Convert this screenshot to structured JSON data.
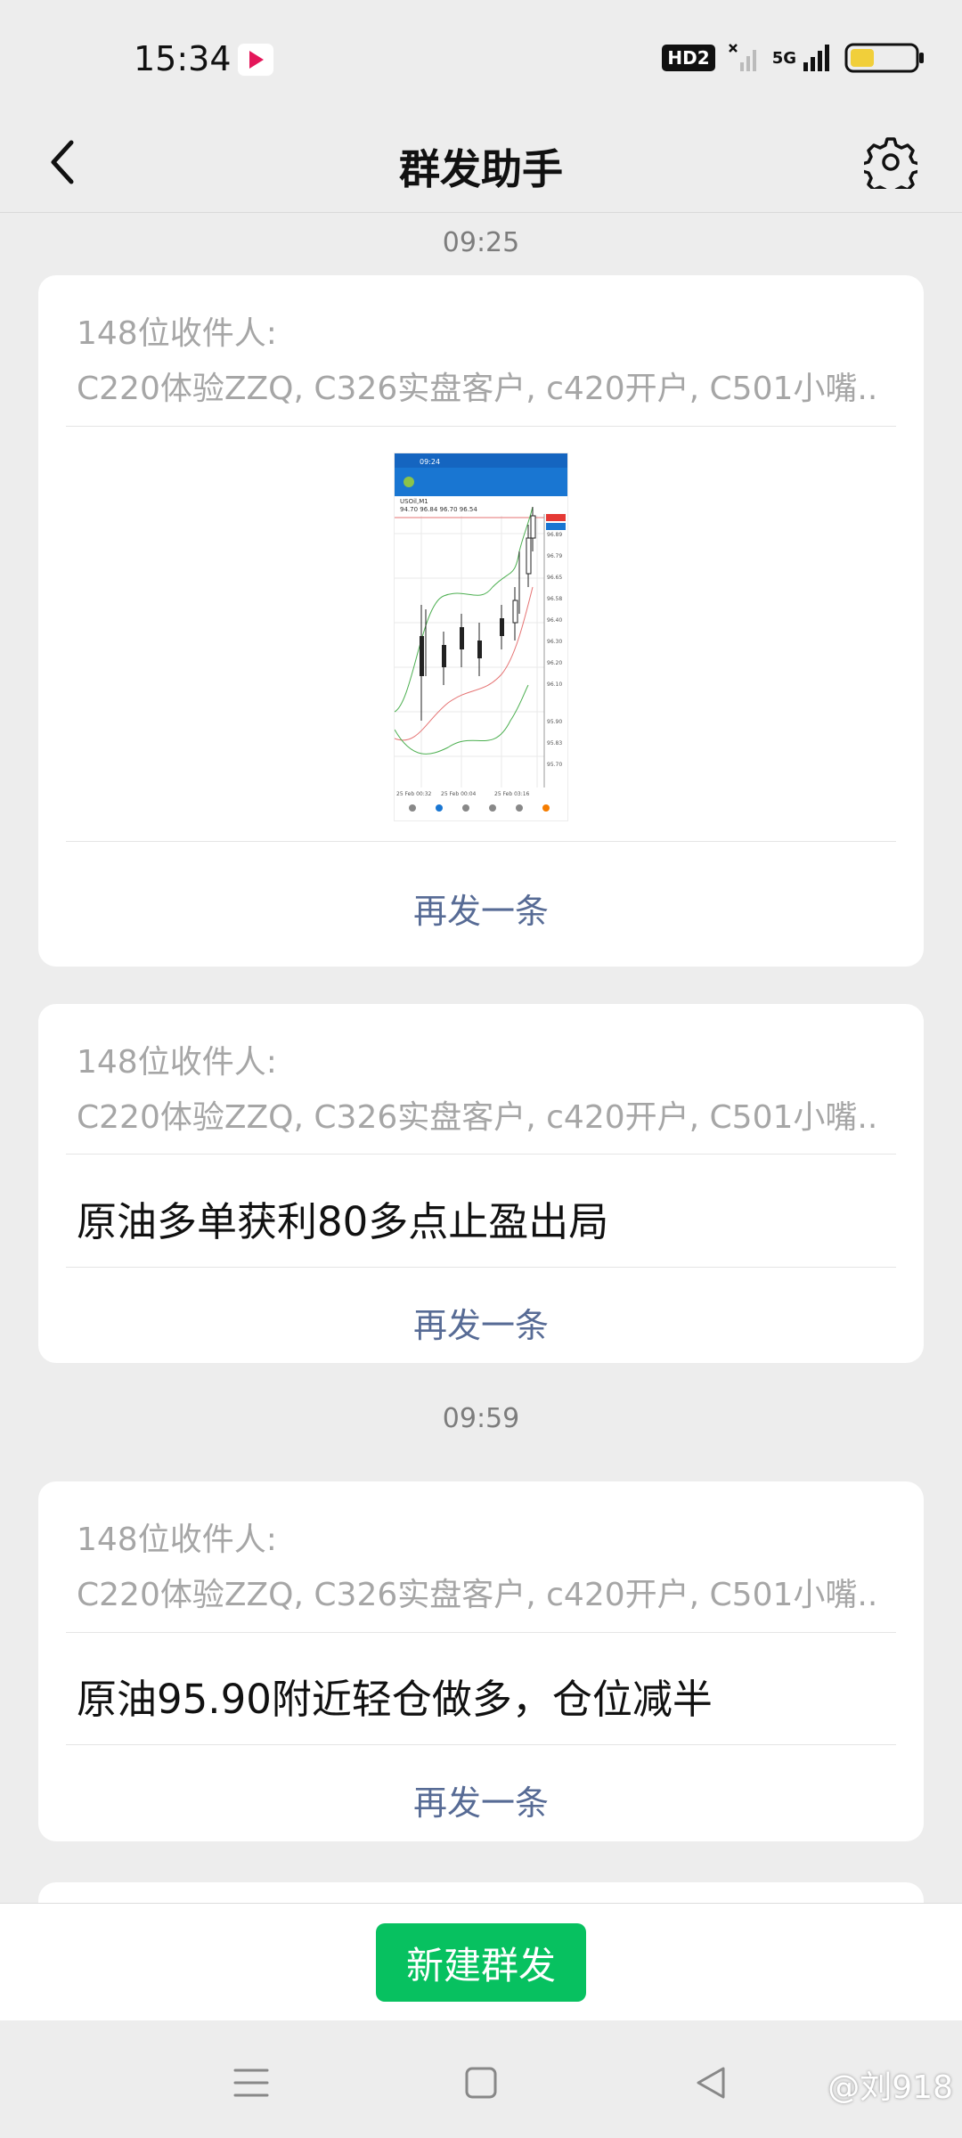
{
  "status_bar": {
    "time": "15:34",
    "hd": "HD2",
    "network": "5G"
  },
  "nav": {
    "title": "群发助手"
  },
  "messages": [
    {
      "timestamp": "09:25",
      "recipients_label": "148位收件人:",
      "recipients": "C220体验ZZQ, C326实盘客户, c420开户, C501小嘴...",
      "type": "image",
      "resend_label": "再发一条"
    },
    {
      "recipients_label": "148位收件人:",
      "recipients": "C220体验ZZQ, C326实盘客户, c420开户, C501小嘴...",
      "text": "原油多单获利80多点止盈出局",
      "resend_label": "再发一条"
    },
    {
      "timestamp": "09:59",
      "recipients_label": "148位收件人:",
      "recipients": "C220体验ZZQ, C326实盘客户, c420开户, C501小嘴...",
      "text": "原油95.90附近轻仓做多，仓位减半",
      "resend_label": "再发一条"
    }
  ],
  "image_thumb": {
    "time": "09:24",
    "symbol": "USOil,M1",
    "quote": "94.70 96.84 96.70 96.54",
    "price_labels": [
      "96.89",
      "96.79",
      "96.65",
      "96.58",
      "96.40",
      "96.30",
      "96.20",
      "96.10",
      "95.90",
      "95.83",
      "95.70"
    ],
    "date_labels": [
      "25 Feb 00:32",
      "25 Feb 00:04",
      "25 Feb 03:16"
    ]
  },
  "bottom": {
    "new_button": "新建群发"
  },
  "watermark": "@刘918",
  "colors": {
    "accent_green": "#07c160",
    "link_blue": "#576b95",
    "background": "#ededed"
  }
}
